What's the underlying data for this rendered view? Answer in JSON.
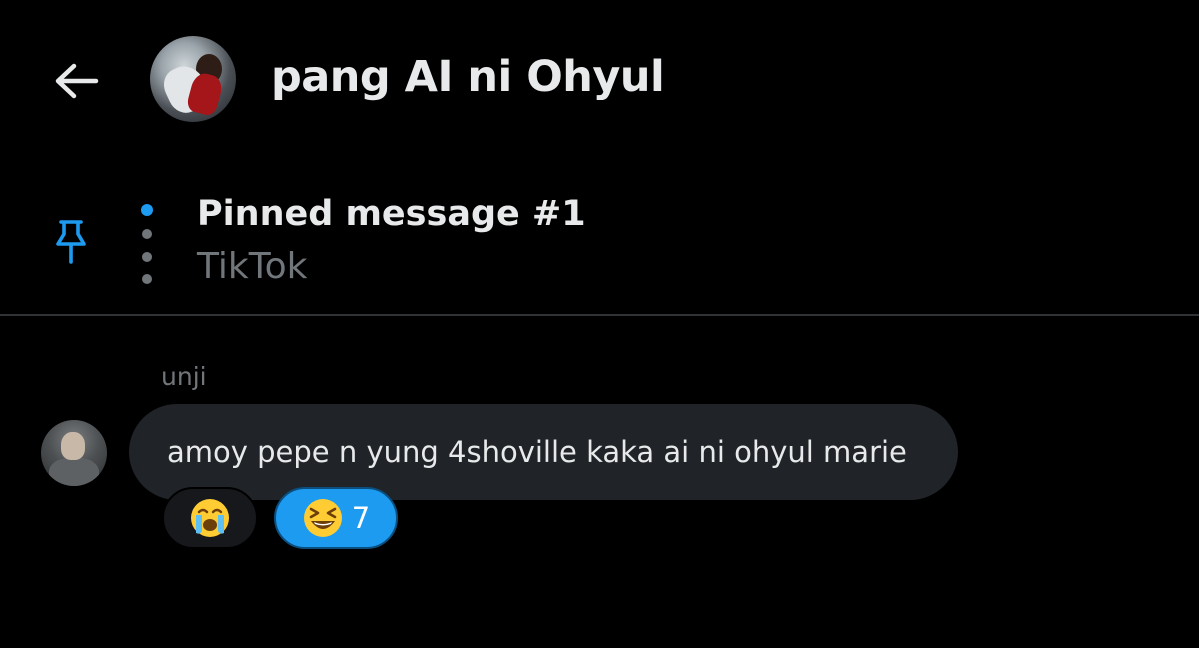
{
  "header": {
    "back_icon": "arrow-left-icon",
    "title": "pang AI ni Ohyul"
  },
  "pinned": {
    "icon": "pin-icon",
    "title": "Pinned message #1",
    "subtitle": "TikTok",
    "active_dot_color": "#1d9bf0",
    "inactive_dot_color": "#71767b"
  },
  "message": {
    "sender": "unji",
    "text": "amoy pepe n yung 4shoville kaka ai ni ohyul marie",
    "reactions": [
      {
        "emoji": "loudly-crying-face-emoji",
        "count": "",
        "selected": false
      },
      {
        "emoji": "grinning-squinting-face-emoji",
        "count": "7",
        "selected": true
      }
    ]
  },
  "colors": {
    "background": "#000000",
    "accent": "#1d9bf0",
    "bubble": "#202327",
    "muted_text": "#71767b",
    "primary_text": "#e7e9ea"
  }
}
